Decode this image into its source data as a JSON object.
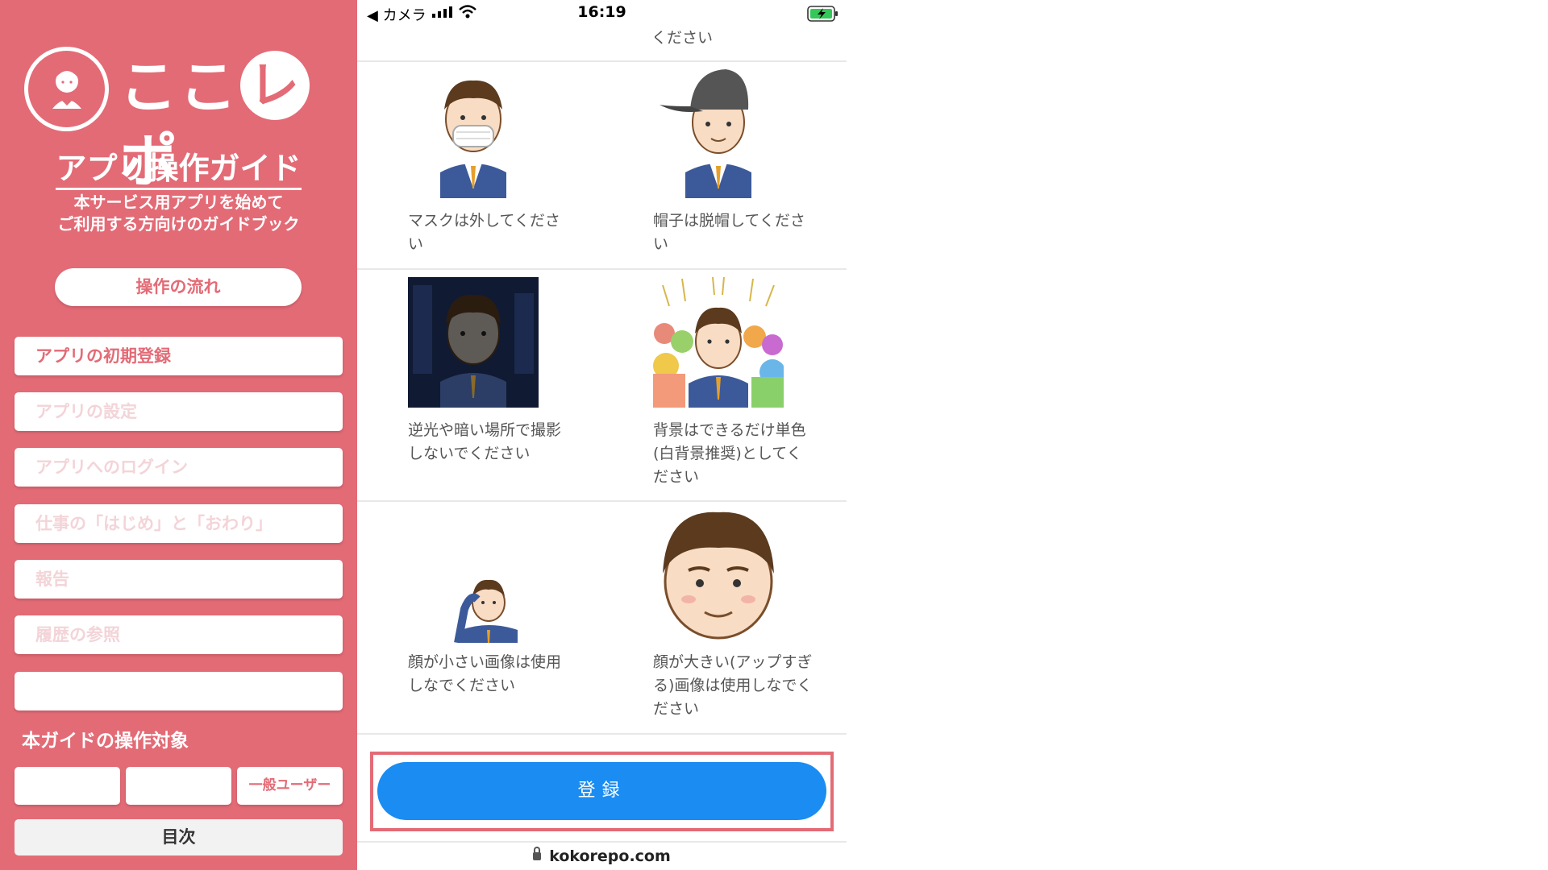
{
  "sidebar": {
    "logo_text_a": "ここ",
    "logo_text_b": "レ",
    "logo_text_c": "ポ",
    "guide_title": "アプリ操作ガイド",
    "guide_subtitle_1": "本サービス用アプリを始めて",
    "guide_subtitle_2": "ご利用する方向けのガイドブック",
    "flow_button": "操作の流れ",
    "menu": [
      {
        "label": "アプリの初期登録"
      },
      {
        "label": "アプリの設定"
      },
      {
        "label": "アプリへのログイン"
      },
      {
        "label": "仕事の「はじめ」と「おわり」"
      },
      {
        "label": "報告"
      },
      {
        "label": "履歴の参照"
      },
      {
        "label": ""
      }
    ],
    "target_label": "本ガイドの操作対象",
    "targets": [
      "",
      "",
      "一般ユーザー"
    ],
    "toc_button": "目次"
  },
  "status_bar": {
    "back_label": "◀ カメラ",
    "time": "16:19"
  },
  "content": {
    "top_caption": "ください",
    "cells": [
      {
        "caption": "マスクは外してください"
      },
      {
        "caption": "帽子は脱帽してください"
      },
      {
        "caption": "逆光や暗い場所で撮影しないでください"
      },
      {
        "caption": "背景はできるだけ単色(白背景推奨)としてください"
      },
      {
        "caption": "顔が小さい画像は使用しなでください"
      },
      {
        "caption": "顔が大きい(アップすぎる)画像は使用しなでください"
      }
    ],
    "register_button": "登録"
  },
  "url_bar": {
    "domain": "kokorepo.com"
  },
  "colors": {
    "accent": "#e36b76",
    "primary_button": "#1a8cf2"
  }
}
